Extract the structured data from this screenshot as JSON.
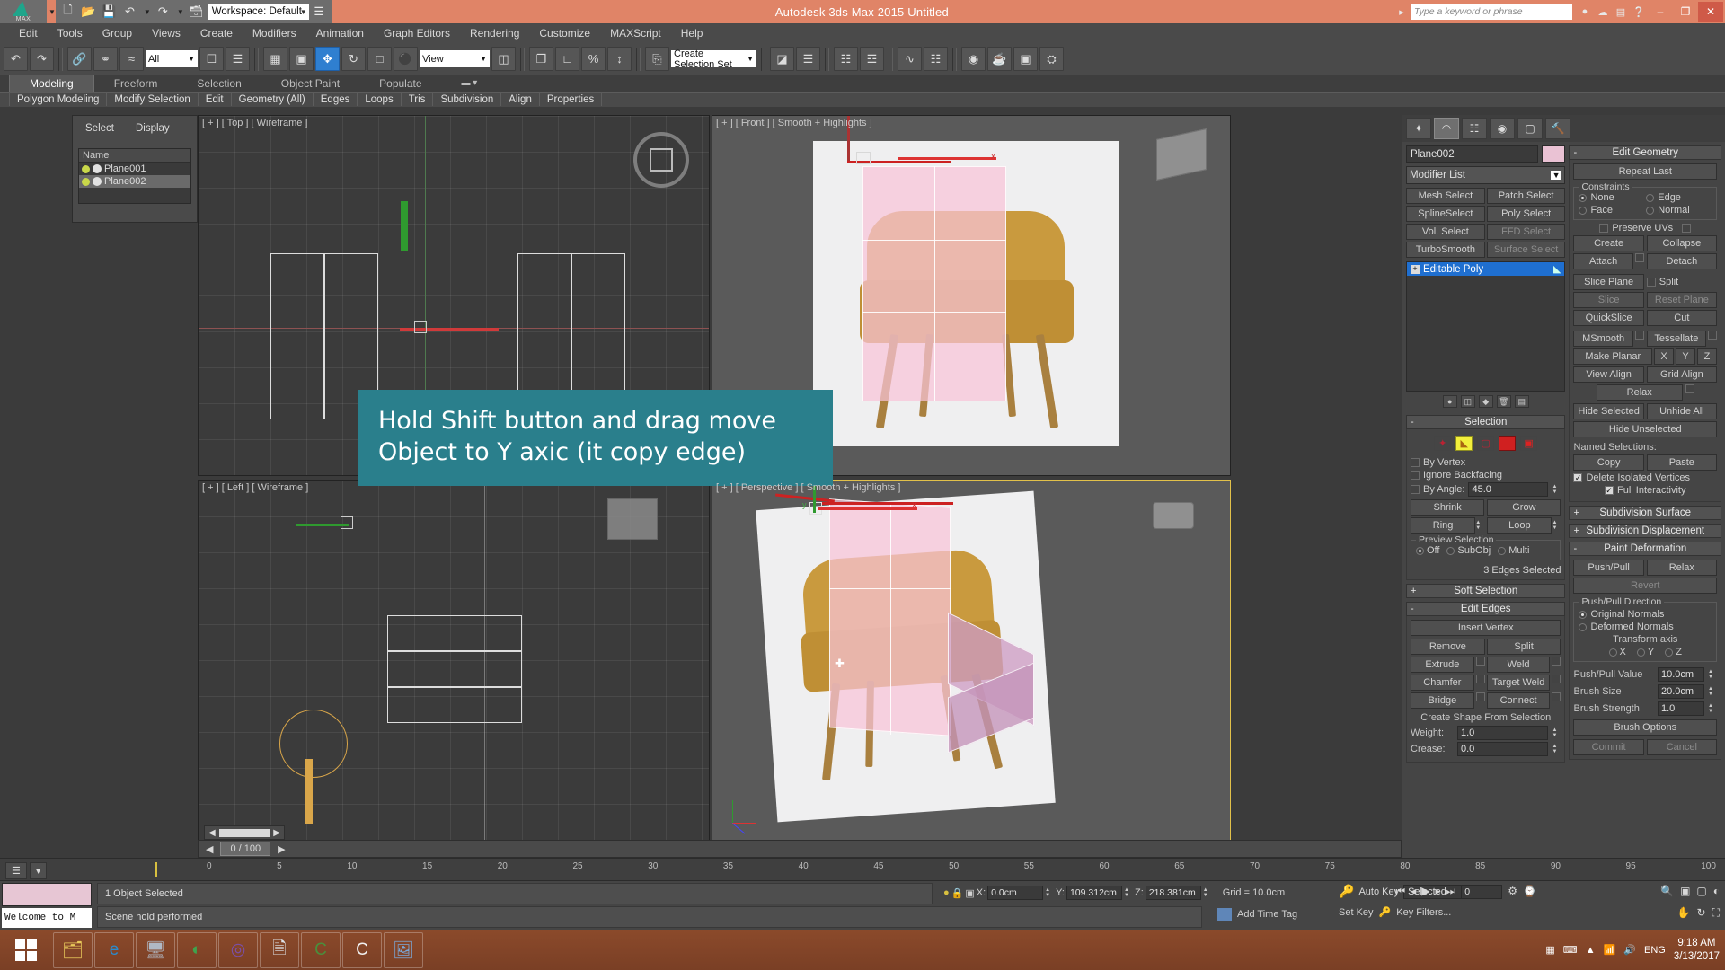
{
  "window": {
    "app_title": "Autodesk 3ds Max  2015    Untitled",
    "workspace": "Workspace: Default",
    "search_placeholder": "Type a keyword or phrase",
    "minimize": "–",
    "maximize": "❐",
    "close": "✕"
  },
  "menu": {
    "items": [
      "Edit",
      "Tools",
      "Group",
      "Views",
      "Create",
      "Modifiers",
      "Animation",
      "Graph Editors",
      "Rendering",
      "Customize",
      "MAXScript",
      "Help"
    ]
  },
  "toolbar": {
    "undo": "↶",
    "redo": "↷",
    "select_filter": "All",
    "reference_coordinate": "View",
    "named_selection_sets": "Create Selection Set",
    "icons": [
      "link-icon",
      "unlink-icon",
      "bind-space-warp-icon",
      "select-object-icon",
      "select-by-name-icon",
      "rect-select-icon",
      "window-crossing-icon",
      "select-and-move-icon",
      "select-and-rotate-icon",
      "select-and-scale-icon",
      "snap-toggle-icon",
      "angle-snap-icon",
      "percent-snap-icon",
      "spinner-snap-icon",
      "mirror-icon",
      "align-icon",
      "layer-manager-icon",
      "graph-editor-icon",
      "schematic-view-icon",
      "material-editor-icon",
      "render-setup-icon",
      "render-frame-icon",
      "render-production-icon"
    ]
  },
  "ribbon": {
    "tabs": [
      "Modeling",
      "Freeform",
      "Selection",
      "Object Paint",
      "Populate"
    ],
    "active_tab": "Modeling",
    "sub_items": [
      "Polygon Modeling",
      "Modify Selection",
      "Edit",
      "Geometry (All)",
      "Edges",
      "Loops",
      "Tris",
      "Subdivision",
      "Align",
      "Properties"
    ]
  },
  "scene_explorer": {
    "menus": [
      "Select",
      "Display"
    ],
    "column_header": "Name",
    "objects": [
      {
        "name": "Plane001",
        "selected": false
      },
      {
        "name": "Plane002",
        "selected": true
      }
    ]
  },
  "viewports": [
    {
      "id": "top",
      "label": "[ + ] [ Top ] [ Wireframe ]",
      "active": false
    },
    {
      "id": "front",
      "label": "[ + ] [ Front ] [ Smooth + Highlights ]",
      "active": false
    },
    {
      "id": "left",
      "label": "[ + ] [ Left ] [ Wireframe ]",
      "active": false
    },
    {
      "id": "persp",
      "label": "[ + ] [ Perspective ] [ Smooth + Highlights ]",
      "active": true
    }
  ],
  "callout": {
    "text": "Hold Shift button and drag move Object to  Y axic (it copy edge)",
    "color": "#2a7f8c"
  },
  "command_panel": {
    "tabs": [
      "create-tab",
      "modify-tab",
      "hierarchy-tab",
      "motion-tab",
      "display-tab",
      "utilities-tab"
    ],
    "active_tab_index": 1,
    "object_name": "Plane002",
    "object_color": "#eac2d4",
    "modifier_list_label": "Modifier List",
    "modifier_buttons": [
      "Mesh Select",
      "Patch Select",
      "SplineSelect",
      "Poly Select",
      "Vol. Select",
      "FFD Select",
      "TurboSmooth",
      "Surface Select"
    ],
    "stack": [
      {
        "label": "Editable Poly",
        "selected": true
      }
    ],
    "selection": {
      "title": "Selection",
      "sub_object_icons": [
        "vertex-icon",
        "edge-icon",
        "border-icon",
        "polygon-icon",
        "element-icon"
      ],
      "active_sub_object": "edge-icon",
      "by_vertex": "By Vertex",
      "ignore_backfacing": "Ignore Backfacing",
      "by_angle": "By Angle:",
      "by_angle_value": "45.0",
      "shrink": "Shrink",
      "grow": "Grow",
      "ring": "Ring",
      "loop": "Loop",
      "preview_selection": "Preview Selection",
      "preview_options": [
        "Off",
        "SubObj",
        "Multi"
      ],
      "preview_selected": "Off",
      "status": "3 Edges Selected"
    },
    "soft_selection_title": "Soft Selection",
    "edit_edges": {
      "title": "Edit Edges",
      "insert_vertex": "Insert Vertex",
      "buttons": [
        "Remove",
        "Split",
        "Extrude",
        "Weld",
        "Chamfer",
        "Target Weld",
        "Bridge",
        "Connect"
      ],
      "create_shape": "Create Shape From Selection",
      "weight_label": "Weight:",
      "weight_value": "1.0",
      "crease_label": "Crease:",
      "crease_value": "0.0"
    },
    "edit_geometry": {
      "title": "Edit Geometry",
      "repeat_last": "Repeat Last",
      "constraints_label": "Constraints",
      "constraints": [
        "None",
        "Edge",
        "Face",
        "Normal"
      ],
      "constraint_selected": "None",
      "preserve_uvs": "Preserve UVs",
      "buttons": [
        "Create",
        "Collapse",
        "Attach",
        "Detach",
        "Slice Plane",
        "Split",
        "Slice",
        "Reset Plane",
        "QuickSlice",
        "Cut",
        "MSmooth",
        "Tessellate",
        "Make Planar",
        "View Align",
        "Grid Align",
        "Relax",
        "Hide Selected",
        "Unhide All",
        "Hide Unselected"
      ],
      "axis_buttons": [
        "X",
        "Y",
        "Z"
      ],
      "named_selections": "Named Selections:",
      "copy": "Copy",
      "paste": "Paste",
      "delete_isolated": "Delete Isolated Vertices",
      "full_interactivity": "Full Interactivity"
    },
    "subdivision_surface": "Subdivision Surface",
    "subdivision_displacement": "Subdivision Displacement",
    "paint_deformation": {
      "title": "Paint Deformation",
      "push_pull": "Push/Pull",
      "relax": "Relax",
      "revert": "Revert",
      "direction_label": "Push/Pull Direction",
      "directions": [
        "Original Normals",
        "Deformed Normals",
        "Transform axis"
      ],
      "direction_selected": "Original Normals",
      "axes": [
        "X",
        "Y",
        "Z"
      ],
      "push_pull_value_label": "Push/Pull Value",
      "push_pull_value": "10.0cm",
      "brush_size_label": "Brush Size",
      "brush_size": "20.0cm",
      "brush_strength_label": "Brush Strength",
      "brush_strength": "1.0",
      "brush_options": "Brush Options",
      "commit": "Commit",
      "cancel": "Cancel"
    }
  },
  "timeline": {
    "frame_readout": "0 / 100",
    "ticks": [
      "0",
      "5",
      "10",
      "15",
      "20",
      "25",
      "30",
      "35",
      "40",
      "45",
      "50",
      "55",
      "60",
      "65",
      "70",
      "75",
      "80",
      "85",
      "90",
      "95",
      "100"
    ]
  },
  "status_bar": {
    "mini_listener": "Welcome to M",
    "selection_status": "1 Object Selected",
    "prompt": "Scene hold performed",
    "x_label": "X:",
    "x_value": "0.0cm",
    "y_label": "Y:",
    "y_value": "109.312cm",
    "z_label": "Z:",
    "z_value": "218.381cm",
    "grid": "Grid = 10.0cm",
    "add_time_tag": "Add Time Tag",
    "auto_key": "Auto Key",
    "set_key": "Set Key",
    "selected_filter": "Selected",
    "key_filters": "Key Filters...",
    "frame_field": "0"
  },
  "taskbar": {
    "start": "start-icon",
    "apps": [
      "file-explorer-icon",
      "internet-explorer-icon",
      "media-player-icon",
      "opera-icon",
      "bittorrent-icon",
      "notepad-icon",
      "corel-icon",
      "corel-draw-icon",
      "photo-viewer-icon"
    ],
    "tray": [
      "show-desktop-icon",
      "keyboard-icon",
      "up-arrow-icon",
      "network-icon",
      "volume-icon"
    ],
    "language": "ENG",
    "time": "9:18 AM",
    "date": "3/13/2017"
  }
}
